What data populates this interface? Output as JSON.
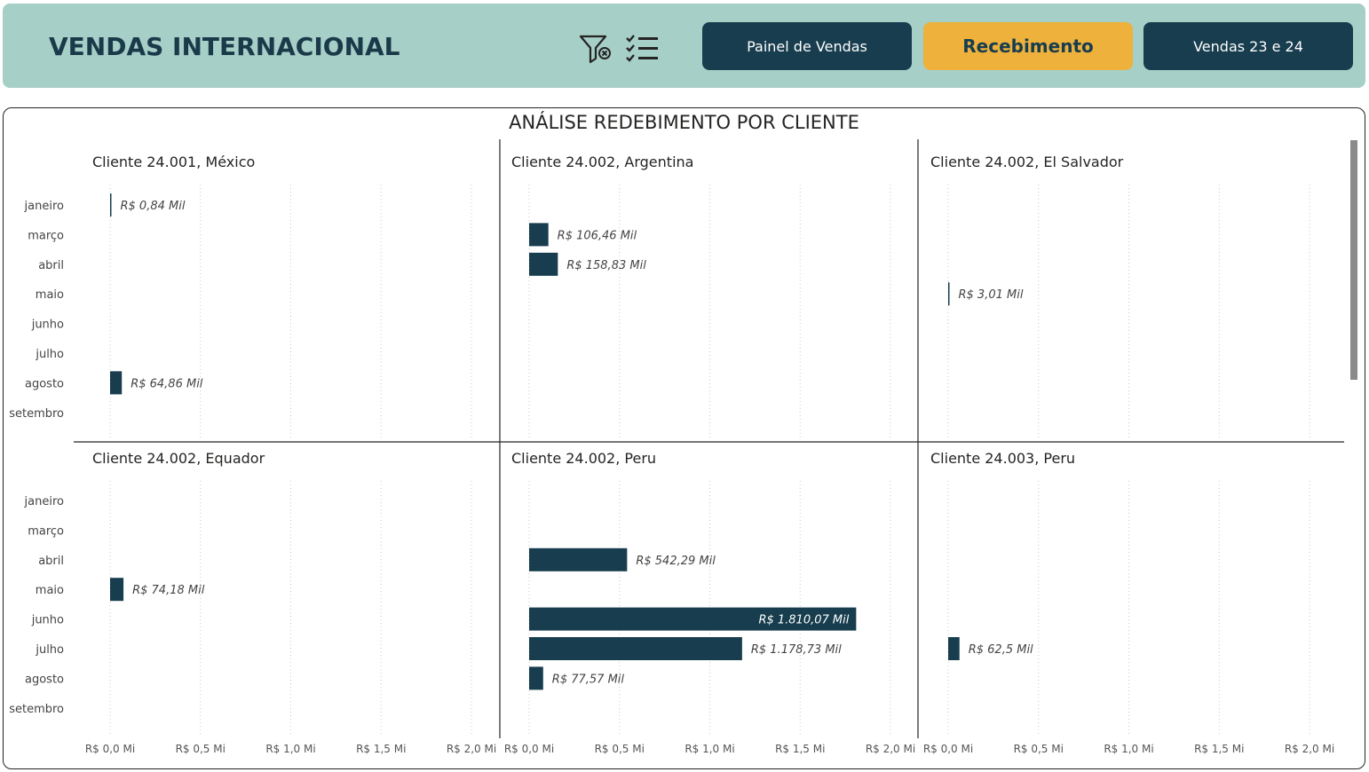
{
  "header": {
    "title": "VENDAS INTERNACIONAL",
    "icons": {
      "clear_filter": "filter-clear-icon",
      "checklist": "checklist-icon"
    },
    "nav": [
      {
        "label": "Painel de Vendas",
        "active": false
      },
      {
        "label": "Recebimento",
        "active": true
      },
      {
        "label": "Vendas 23 e 24",
        "active": false
      }
    ],
    "colors": {
      "header_bg": "#a6cfc7",
      "nav_bg": "#173d4e",
      "active_bg": "#eeb13b"
    }
  },
  "panel": {
    "title": "ANÁLISE REDEBIMENTO POR CLIENTE"
  },
  "chart_data": {
    "type": "bar",
    "orientation": "horizontal",
    "title": "ANÁLISE REDEBIMENTO POR CLIENTE",
    "categories": [
      "janeiro",
      "março",
      "abril",
      "maio",
      "junho",
      "julho",
      "agosto",
      "setembro"
    ],
    "x_ticks": [
      "R$ 0,0 Mi",
      "R$ 0,5 Mi",
      "R$ 1,0 Mi",
      "R$ 1,5 Mi",
      "R$ 2,0 Mi"
    ],
    "xlim": [
      0,
      2.0
    ],
    "x_unit": "R$ Mi",
    "grid": true,
    "bar_color": "#173d4e",
    "panels": [
      {
        "name": "Cliente 24.001, México",
        "bars": [
          {
            "month": "janeiro",
            "value": 0.00084,
            "label": "R$ 0,84 Mil"
          },
          {
            "month": "agosto",
            "value": 0.06486,
            "label": "R$ 64,86 Mil"
          }
        ]
      },
      {
        "name": "Cliente 24.002, Argentina",
        "bars": [
          {
            "month": "março",
            "value": 0.10646,
            "label": "R$ 106,46 Mil"
          },
          {
            "month": "abril",
            "value": 0.15883,
            "label": "R$ 158,83 Mil"
          }
        ]
      },
      {
        "name": "Cliente 24.002, El Salvador",
        "bars": [
          {
            "month": "maio",
            "value": 0.00301,
            "label": "R$ 3,01 Mil"
          }
        ]
      },
      {
        "name": "Cliente 24.002, Equador",
        "bars": [
          {
            "month": "maio",
            "value": 0.07418,
            "label": "R$ 74,18 Mil"
          }
        ]
      },
      {
        "name": "Cliente 24.002, Peru",
        "bars": [
          {
            "month": "abril",
            "value": 0.54229,
            "label": "R$ 542,29 Mil"
          },
          {
            "month": "junho",
            "value": 1.81007,
            "label": "R$ 1.810,07 Mil"
          },
          {
            "month": "julho",
            "value": 1.17873,
            "label": "R$ 1.178,73 Mil"
          },
          {
            "month": "agosto",
            "value": 0.07757,
            "label": "R$ 77,57 Mil"
          }
        ]
      },
      {
        "name": "Cliente 24.003, Peru",
        "bars": [
          {
            "month": "julho",
            "value": 0.0625,
            "label": "R$ 62,5 Mil"
          }
        ]
      }
    ]
  }
}
